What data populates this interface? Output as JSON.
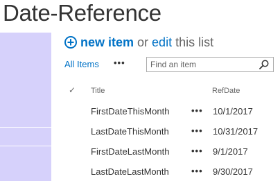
{
  "page": {
    "title": "Date-Reference"
  },
  "commands": {
    "new_item": "new item",
    "or": "or",
    "edit": "edit",
    "this_list": "this list"
  },
  "views": {
    "all_items": "All Items",
    "more": "•••"
  },
  "search": {
    "placeholder": "Find an item"
  },
  "list": {
    "columns": {
      "check": "✓",
      "title": "Title",
      "refdate": "RefDate"
    },
    "rows": [
      {
        "title": "FirstDateThisMonth",
        "refdate": "10/1/2017"
      },
      {
        "title": "LastDateThisMonth",
        "refdate": "10/31/2017"
      },
      {
        "title": "FirstDateLastMonth",
        "refdate": "9/1/2017"
      },
      {
        "title": "LastDateLastMonth",
        "refdate": "9/30/2017"
      }
    ],
    "row_menu": "•••"
  },
  "colors": {
    "accent": "#0072c6",
    "sidebar": "#d6d1fb",
    "text": "#333333"
  }
}
